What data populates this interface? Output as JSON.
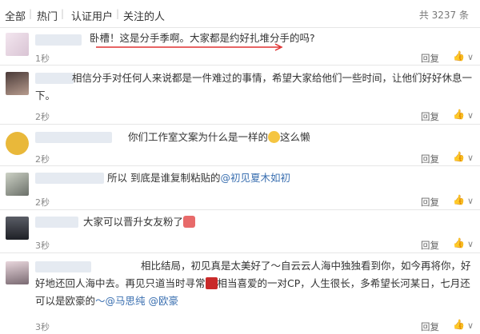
{
  "tabs": [
    {
      "label": "全部"
    },
    {
      "label": "热门"
    },
    {
      "label": "认证用户"
    },
    {
      "label": "关注的人"
    }
  ],
  "total_count": "共 3237 条",
  "reply_label": "回复",
  "comments": [
    {
      "text": "卧槽！这是分手季啊。大家都是约好扎堆分手的吗?",
      "time": "1秒"
    },
    {
      "text": "相信分手对任何人来说都是一件难过的事情，希望大家给他们一些时间，让他们好好休息一下。",
      "time": "2秒"
    },
    {
      "text_before": "你们工作室文案为什么是一样的",
      "text_after": "这么懒",
      "time": "2秒"
    },
    {
      "text": "所以 到底是谁复制粘贴的",
      "mention": "@初见夏木如初",
      "time": "2秒"
    },
    {
      "text": "大家可以晋升女友粉了",
      "time": "3秒"
    },
    {
      "text_part1": "相比结局，初见真是太美好了～自云云人海中独独看到你，如今再将你，好好地还回人海中去。再见只道当时寻常",
      "text_part2": "相当喜爱的一对CP，人生很长，多希望长河某日，七月还可以是欧豪的",
      "mentions": [
        "～@马思纯",
        "@欧豪"
      ],
      "time": "3秒"
    }
  ],
  "colors": {
    "accent": "#3a6fb0",
    "separator": "#e6e6e6",
    "annotation": "#e03030"
  }
}
